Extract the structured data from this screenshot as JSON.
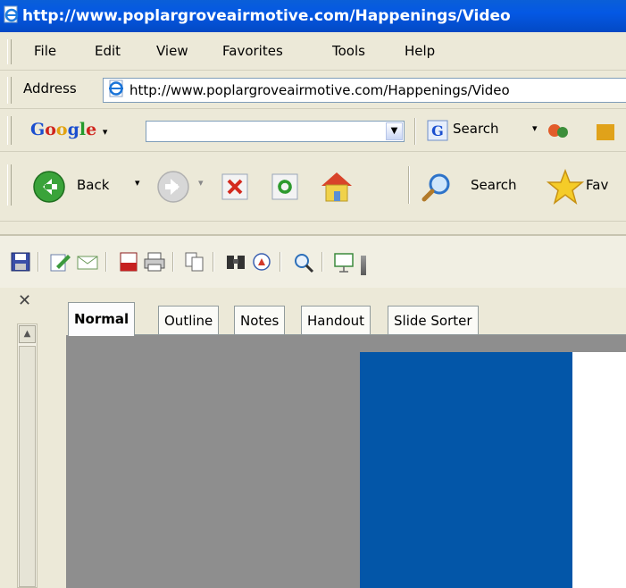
{
  "window": {
    "title": "http://www.poplargroveairmotive.com/Happenings/Video"
  },
  "menubar": {
    "items": [
      "File",
      "Edit",
      "View",
      "Favorites",
      "Tools",
      "Help"
    ]
  },
  "address": {
    "label": "Address",
    "url": "http://www.poplargroveairmotive.com/Happenings/Video"
  },
  "google": {
    "logo": "Google",
    "search_value": "",
    "search_label": "Search"
  },
  "std": {
    "back_label": "Back",
    "search_label": "Search",
    "favorites_label": "Fav"
  },
  "tabs": [
    {
      "label": "Normal",
      "active": true
    },
    {
      "label": "Outline",
      "active": false
    },
    {
      "label": "Notes",
      "active": false
    },
    {
      "label": "Handout",
      "active": false
    },
    {
      "label": "Slide Sorter",
      "active": false
    }
  ],
  "colors": {
    "titlebar": "#0458e4",
    "slide_background": "#0356a8",
    "workarea": "#8e8e8e"
  }
}
